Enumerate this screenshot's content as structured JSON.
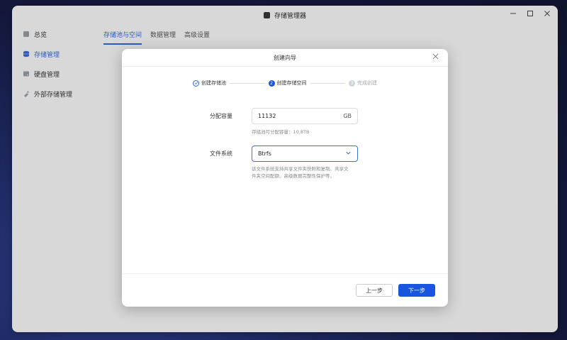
{
  "window": {
    "title": "存储管理器"
  },
  "sidebar": {
    "items": [
      {
        "label": "总览",
        "icon": "overview-icon"
      },
      {
        "label": "存储管理",
        "icon": "storage-icon"
      },
      {
        "label": "硬盘管理",
        "icon": "disk-icon"
      },
      {
        "label": "外部存储管理",
        "icon": "external-storage-icon"
      }
    ],
    "active_index": 1
  },
  "tabs": [
    "存储池与空间",
    "数据管理",
    "高级设置"
  ],
  "dialog": {
    "title": "创建向导",
    "steps": [
      {
        "label": "创建存储池",
        "state": "done"
      },
      {
        "label": "创建存储空间",
        "state": "active",
        "num": "2"
      },
      {
        "label": "完成创建",
        "state": "idle",
        "num": "3"
      }
    ],
    "capacity": {
      "label": "分配容量",
      "value": "11132",
      "unit": "GB",
      "hint": "存储池可分配容量：10.8TB"
    },
    "filesystem": {
      "label": "文件系统",
      "value": "Btrfs",
      "hint_line1": "该文件系统支持共享文件夹快照和复制、共享文",
      "hint_line2": "件夹空间配额、高级数据完整性保护等。"
    },
    "buttons": {
      "prev": "上一步",
      "next": "下一步"
    }
  },
  "colors": {
    "accent": "#1a55e0",
    "sidebar_active": "#3366dd"
  }
}
